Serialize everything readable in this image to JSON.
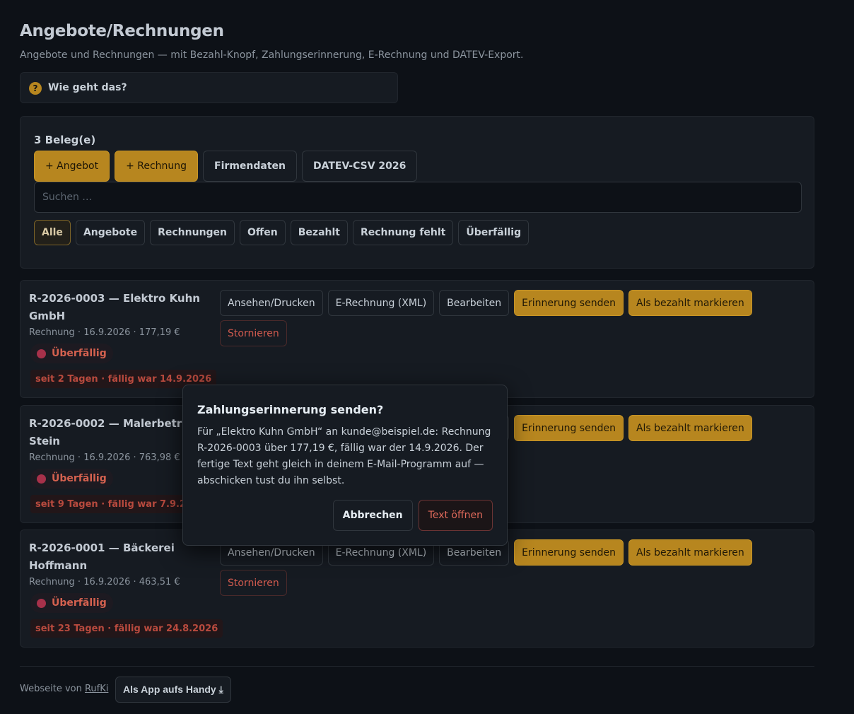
{
  "header": {
    "title": "Angebote/Rechnungen",
    "subtitle": "Angebote und Rechnungen — mit Bezahl-Knopf, Zahlungserinnerung, E-Rechnung und DATEV-Export.",
    "howto_label": "Wie geht das?",
    "howto_icon": "?"
  },
  "panel": {
    "count_label": "3 Beleg(e)",
    "buttons": {
      "new_offer": "+ Angebot",
      "new_invoice": "+ Rechnung",
      "company": "Firmendaten",
      "datev": "DATEV-CSV 2026"
    },
    "search_placeholder": "Suchen …",
    "filters": [
      "Alle",
      "Angebote",
      "Rechnungen",
      "Offen",
      "Bezahlt",
      "Rechnung fehlt",
      "Überfällig"
    ],
    "active_filter": "Alle"
  },
  "actions": {
    "view": "Ansehen/Drucken",
    "xml": "E-Rechnung (XML)",
    "edit": "Bearbeiten",
    "remind": "Erinnerung senden",
    "paid": "Als bezahlt markieren",
    "cancel": "Stornieren"
  },
  "documents": [
    {
      "title": "R-2026-0003 — Elektro Kuhn GmbH",
      "meta": "Rechnung · 16.9.2026 · 177,19 €",
      "status": "Überfällig",
      "warning": "seit 2 Tagen · fällig war 14.9.2026"
    },
    {
      "title": "R-2026-0002 — Malerbetrieb Stein",
      "meta": "Rechnung · 16.9.2026 · 763,98 €",
      "status": "Überfällig",
      "warning": "seit 9 Tagen · fällig war 7.9.2026"
    },
    {
      "title": "R-2026-0001 — Bäckerei Hoffmann",
      "meta": "Rechnung · 16.9.2026 · 463,51 €",
      "status": "Überfällig",
      "warning": "seit 23 Tagen · fällig war 24.8.2026"
    }
  ],
  "footer": {
    "text": "Webseite von",
    "link": "RufKi",
    "app_button": "Als App aufs Handy ⤓"
  },
  "dialog": {
    "title": "Zahlungserinnerung senden?",
    "body": "Für „Elektro Kuhn GmbH“ an kunde@beispiel.de: Rechnung R-2026-0003 über 177,19 €, fällig war der 14.9.2026. Der fertige Text geht gleich in deinem E-Mail-Programm auf — abschicken tust du ihn selbst.",
    "cancel": "Abbrechen",
    "confirm": "Text öffnen"
  },
  "colors": {
    "background": "#0d1117",
    "surface": "#161b22",
    "accent_gold": "#b7861f",
    "danger": "#d05a4e"
  }
}
